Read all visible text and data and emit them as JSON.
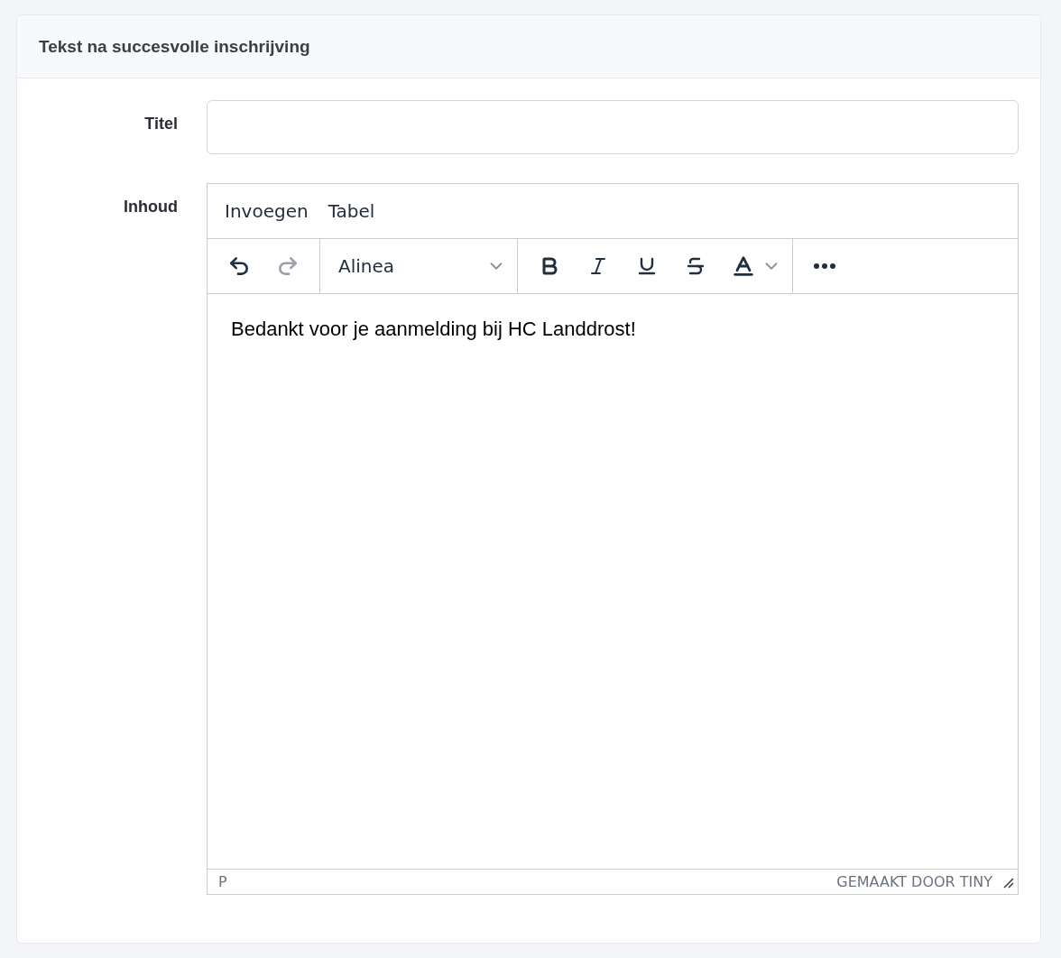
{
  "card": {
    "title": "Tekst na succesvolle inschrijving"
  },
  "fields": [
    {
      "label": "Titel",
      "kind": "input"
    },
    {
      "label": "Inhoud",
      "kind": "editor"
    }
  ],
  "editor": {
    "menu": [
      "Invoegen",
      "Tabel"
    ],
    "toolbar": [
      [
        {
          "kind": "undo",
          "disabled": false
        },
        {
          "kind": "redo",
          "disabled": true
        }
      ],
      [
        {
          "kind": "blocks",
          "label": "Alinea"
        }
      ],
      [
        {
          "kind": "bold",
          "disabled": false
        },
        {
          "kind": "italic",
          "disabled": false
        },
        {
          "kind": "underline",
          "disabled": false
        },
        {
          "kind": "strike",
          "disabled": false
        },
        {
          "kind": "color",
          "disabled": false
        }
      ],
      [
        {
          "kind": "more",
          "disabled": false
        }
      ]
    ],
    "content": "Bedankt voor je aanmelding bij HC Landdrost!",
    "path": "P",
    "branding": "GEMAAKT DOOR TINY"
  }
}
